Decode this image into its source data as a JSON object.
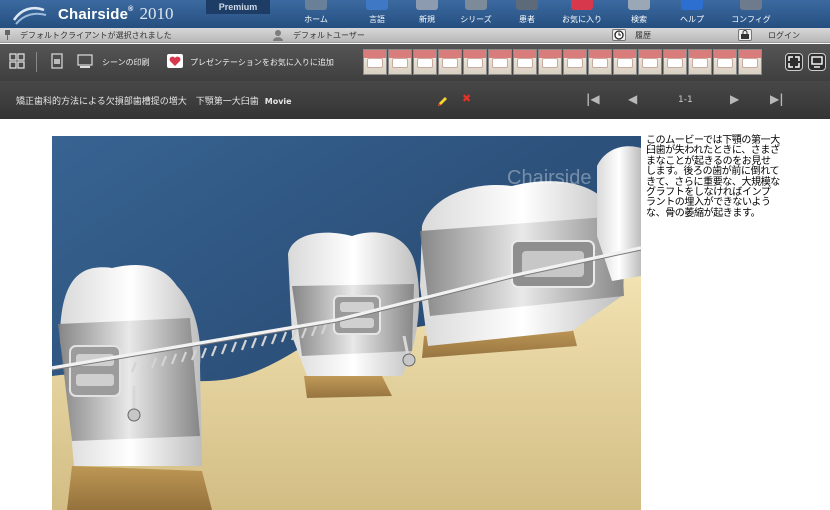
{
  "app": {
    "name": "Chairside",
    "name_mark": "®",
    "year": "2010",
    "edition": "Premium"
  },
  "nav": {
    "items": [
      {
        "label": "ホーム",
        "icon": "home-icon",
        "color": "#6a7f98"
      },
      {
        "label": "言語",
        "icon": "language-icon",
        "color": "#3f79c6"
      },
      {
        "label": "新規",
        "icon": "new-icon",
        "color": "#8c9bb0"
      },
      {
        "label": "シリーズ",
        "icon": "series-icon",
        "color": "#7d8a9a"
      },
      {
        "label": "患者",
        "icon": "patient-icon",
        "color": "#5c6a7a"
      },
      {
        "label": "お気に入り",
        "icon": "favorites-icon",
        "color": "#d8384b"
      },
      {
        "label": "検索",
        "icon": "search-icon",
        "color": "#9aa7b6"
      },
      {
        "label": "ヘルプ",
        "icon": "help-icon",
        "color": "#2d6fd1"
      },
      {
        "label": "コンフィグ",
        "icon": "config-icon",
        "color": "#6d7b8d"
      }
    ]
  },
  "status": {
    "client": "デフォルトクライアントが選択されました",
    "user": "デフォルトユーザー",
    "history": "履歴",
    "login": "ログイン"
  },
  "toolbar": {
    "print_scene": "シーンの印刷",
    "add_favorite": "プレゼンテーションをお気に入りに追加",
    "thumbnail_count": 16
  },
  "titlebar": {
    "title": "矯正歯科的方法による欠損部歯槽提の増大　下顎第一大臼歯",
    "type": "Movie",
    "pager": "1-1"
  },
  "video": {
    "watermark": "Chairside"
  },
  "description": "このムービーでは下顎の第一大臼歯が失われたときに、さまざまなことが起きるのをお見せします。後ろの歯が前に倒れてきて、さらに重要な、大規模なグラフトをしなければインプラントの埋入ができないような、骨の萎縮が起きます。"
}
